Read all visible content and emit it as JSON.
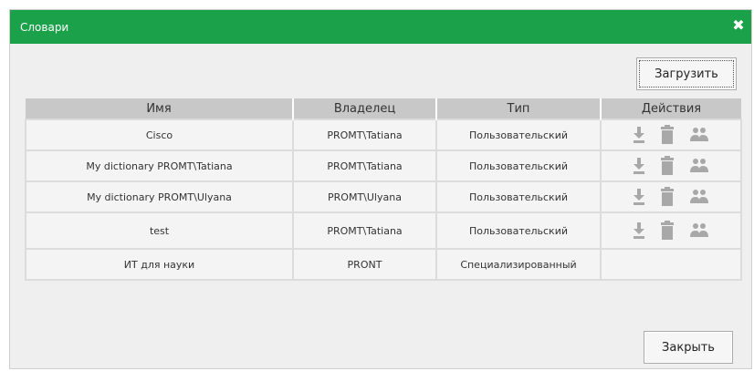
{
  "dialog": {
    "title": "Словари",
    "close_glyph": "✖",
    "load_button": "Загрузить",
    "close_button": "Закрыть"
  },
  "table": {
    "headers": [
      "Имя",
      "Владелец",
      "Тип",
      "Действия"
    ],
    "rows": [
      {
        "name": "Cisco",
        "owner": "PROMT\\Tatiana",
        "type": "Пользовательский",
        "actions": [
          "download-icon",
          "trash-icon",
          "share-users-icon"
        ]
      },
      {
        "name": "My dictionary PROMT\\Tatiana",
        "owner": "PROMT\\Tatiana",
        "type": "Пользовательский",
        "actions": [
          "download-icon",
          "trash-icon",
          "share-users-icon"
        ]
      },
      {
        "name": "My dictionary PROMT\\Ulyana",
        "owner": "PROMT\\Ulyana",
        "type": "Пользовательский",
        "actions": [
          "download-icon",
          "trash-icon",
          "share-users-icon"
        ]
      },
      {
        "name": "test",
        "owner": "PROMT\\Tatiana",
        "type": "Пользовательский",
        "actions": [
          "download-icon",
          "trash-icon",
          "share-users-icon"
        ]
      },
      {
        "name": "ИТ для науки",
        "owner": "PRONT",
        "type": "Специализированный",
        "actions": []
      }
    ]
  },
  "colors": {
    "titlebar": "#1aa14a",
    "header_bg": "#c8c8c8",
    "icon_gray": "#a8a8a8"
  }
}
